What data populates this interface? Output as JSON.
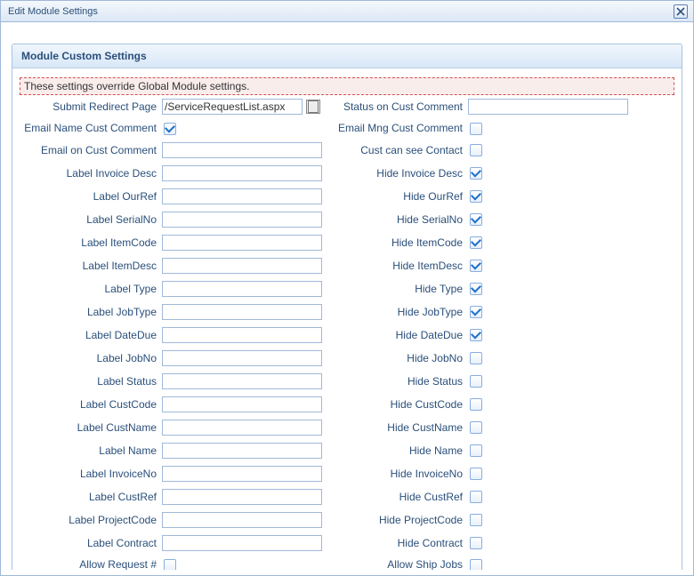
{
  "window": {
    "title": "Edit Module Settings"
  },
  "panel": {
    "title": "Module Custom Settings",
    "notice": "These settings override Global Module settings."
  },
  "fields": {
    "submitRedirect": {
      "label": "Submit Redirect Page",
      "value": "/ServiceRequestList.aspx"
    },
    "statusOnCust": {
      "label": "Status on Cust Comment",
      "value": ""
    },
    "emailNameCust": {
      "label": "Email Name Cust Comment",
      "checked": true
    },
    "emailMngCust": {
      "label": "Email Mng Cust Comment",
      "checked": false
    },
    "emailOnCust": {
      "label": "Email on Cust Comment",
      "value": ""
    },
    "custSeeContact": {
      "label": "Cust can see Contact",
      "checked": false
    },
    "labelInvoiceDesc": {
      "label": "Label Invoice Desc",
      "value": ""
    },
    "hideInvoiceDesc": {
      "label": "Hide Invoice Desc",
      "checked": true
    },
    "labelOurRef": {
      "label": "Label OurRef",
      "value": ""
    },
    "hideOurRef": {
      "label": "Hide OurRef",
      "checked": true
    },
    "labelSerialNo": {
      "label": "Label SerialNo",
      "value": ""
    },
    "hideSerialNo": {
      "label": "Hide SerialNo",
      "checked": true
    },
    "labelItemCode": {
      "label": "Label ItemCode",
      "value": ""
    },
    "hideItemCode": {
      "label": "Hide ItemCode",
      "checked": true
    },
    "labelItemDesc": {
      "label": "Label ItemDesc",
      "value": ""
    },
    "hideItemDesc": {
      "label": "Hide ItemDesc",
      "checked": true
    },
    "labelType": {
      "label": "Label Type",
      "value": ""
    },
    "hideType": {
      "label": "Hide Type",
      "checked": true
    },
    "labelJobType": {
      "label": "Label JobType",
      "value": ""
    },
    "hideJobType": {
      "label": "Hide JobType",
      "checked": true
    },
    "labelDateDue": {
      "label": "Label DateDue",
      "value": ""
    },
    "hideDateDue": {
      "label": "Hide DateDue",
      "checked": true
    },
    "labelJobNo": {
      "label": "Label JobNo",
      "value": ""
    },
    "hideJobNo": {
      "label": "Hide JobNo",
      "checked": false
    },
    "labelStatus": {
      "label": "Label Status",
      "value": ""
    },
    "hideStatus": {
      "label": "Hide Status",
      "checked": false
    },
    "labelCustCode": {
      "label": "Label CustCode",
      "value": ""
    },
    "hideCustCode": {
      "label": "Hide CustCode",
      "checked": false
    },
    "labelCustName": {
      "label": "Label CustName",
      "value": ""
    },
    "hideCustName": {
      "label": "Hide CustName",
      "checked": false
    },
    "labelName": {
      "label": "Label Name",
      "value": ""
    },
    "hideName": {
      "label": "Hide Name",
      "checked": false
    },
    "labelInvoiceNo": {
      "label": "Label InvoiceNo",
      "value": ""
    },
    "hideInvoiceNo": {
      "label": "Hide InvoiceNo",
      "checked": false
    },
    "labelCustRef": {
      "label": "Label CustRef",
      "value": ""
    },
    "hideCustRef": {
      "label": "Hide CustRef",
      "checked": false
    },
    "labelProjectCode": {
      "label": "Label ProjectCode",
      "value": ""
    },
    "hideProjectCode": {
      "label": "Hide ProjectCode",
      "checked": false
    },
    "labelContract": {
      "label": "Label Contract",
      "value": ""
    },
    "hideContract": {
      "label": "Hide Contract",
      "checked": false
    },
    "allowRequest": {
      "label": "Allow Request #",
      "checked": false
    },
    "allowShipJobs": {
      "label": "Allow Ship Jobs",
      "checked": false
    }
  }
}
